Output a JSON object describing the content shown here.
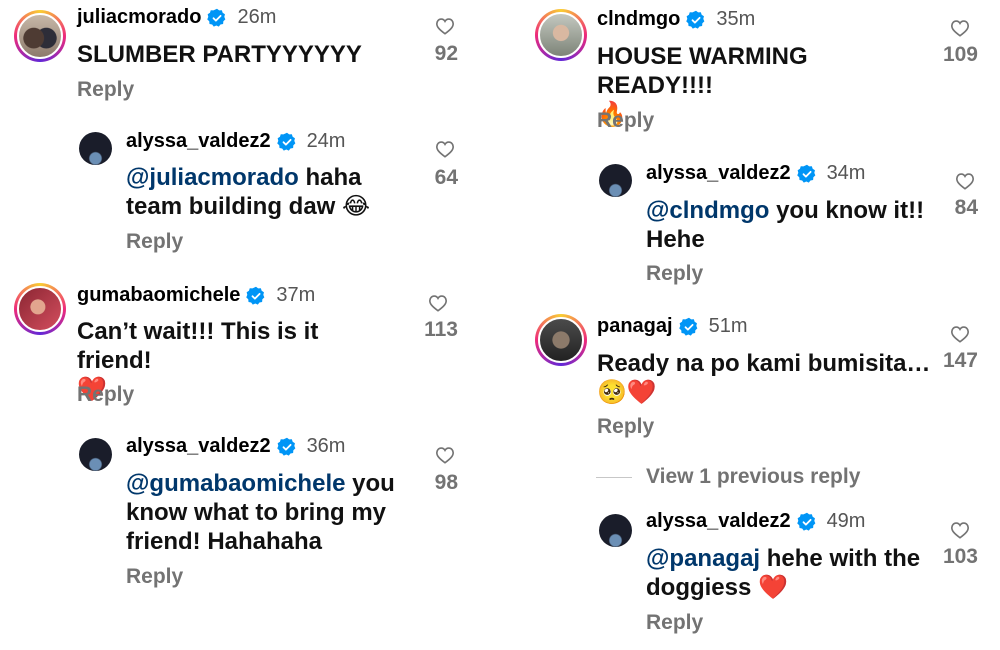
{
  "left": [
    {
      "user": "juliacmorado",
      "time": "26m",
      "likes": "92",
      "text": "SLUMBER PARTYYYYYY",
      "reply": "Reply"
    },
    {
      "user": "alyssa_valdez2",
      "time": "24m",
      "likes": "64",
      "mention": "@juliacmorado",
      "text": " haha team building daw ",
      "emoji": "😂",
      "reply": "Reply"
    },
    {
      "user": "gumabaomichele",
      "time": "37m",
      "likes": "113",
      "text": "Can’t wait!!! This is it friend!",
      "emoji": "❤️",
      "reply": "Reply"
    },
    {
      "user": "alyssa_valdez2",
      "time": "36m",
      "likes": "98",
      "mention": "@gumabaomichele",
      "text": " you know what to bring my friend! Hahahaha",
      "reply": "Reply"
    }
  ],
  "right": [
    {
      "user": "clndmgo",
      "time": "35m",
      "likes": "109",
      "text": "HOUSE WARMING READY!!!!",
      "emoji": "🔥",
      "reply": "Reply"
    },
    {
      "user": "alyssa_valdez2",
      "time": "34m",
      "likes": "84",
      "mention": "@clndmgo",
      "text": " you know it!! Hehe",
      "reply": "Reply"
    },
    {
      "user": "panagaj",
      "time": "51m",
      "likes": "147",
      "text": "Ready na po kami bumisita…",
      "emoji": "🥺❤️",
      "reply": "Reply"
    },
    {
      "view_previous": "View 1 previous reply",
      "user": "alyssa_valdez2",
      "time": "49m",
      "likes": "103",
      "mention": "@panagaj",
      "text": " hehe with the doggiess ",
      "emoji": "❤️",
      "reply": "Reply"
    }
  ],
  "colors": {
    "mention": "#00376b",
    "muted": "#737373",
    "verified": "#0095f6"
  },
  "icons": {
    "verified": "verified-badge-icon",
    "like": "heart-outline-icon"
  }
}
